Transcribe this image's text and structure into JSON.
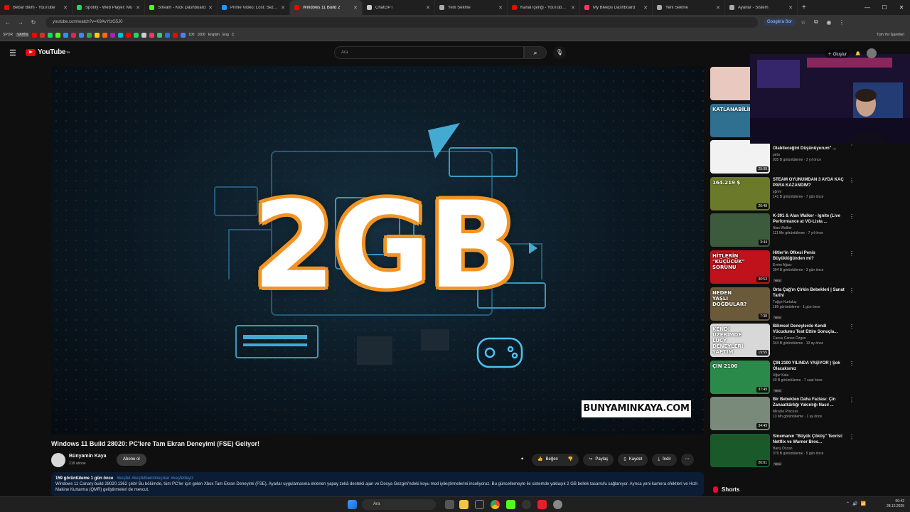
{
  "browser": {
    "tabs": [
      {
        "label": "Bebar Bilim - YouTube",
        "favicon_color": "#ff0000"
      },
      {
        "label": "Spotify - Web Player: Mu",
        "favicon_color": "#1ed760"
      },
      {
        "label": "Stream - Kick Dashboard",
        "favicon_color": "#53fc18"
      },
      {
        "label": "Prime Video: Lost: Sezon",
        "favicon_color": "#1a98ff"
      },
      {
        "label": "Windows 11 Build 2",
        "favicon_color": "#ff0000",
        "active": true
      },
      {
        "label": "ChatGPT",
        "favicon_color": "#cccccc"
      },
      {
        "label": "Yeni Sekme",
        "favicon_color": "#aaaaaa"
      },
      {
        "label": "Kanal içeriği - YouTube S",
        "favicon_color": "#ff0000"
      },
      {
        "label": "My Bleeps Dashboard",
        "favicon_color": "#ff3366"
      },
      {
        "label": "Yeni Sekme",
        "favicon_color": "#aaaaaa"
      },
      {
        "label": "Ayarlar - Sistem",
        "favicon_color": "#aaaaaa"
      }
    ],
    "url": "youtube.com/watch?v=K9AvYlzG5J0",
    "search_chip": "Google'a Sor",
    "bookmarks": [
      "SPOR",
      "VAHİN",
      "100",
      "1000",
      "English",
      "Eng",
      "C"
    ],
    "bookmark_colors": [
      "#ff0000",
      "#d93025",
      "#1ed760",
      "#53fc18",
      "#1a98ff",
      "#e91e63",
      "#4285f4",
      "#34a853",
      "#ffcc00",
      "#ff6d00",
      "#9c27b0",
      "#00bcd4",
      "#ff0000",
      "#1ed760",
      "#cccccc",
      "#ff3366",
      "#25d366",
      "#1877f2",
      "#ff0000",
      "#4285f4"
    ],
    "bookmarks_right": "Tüm Yer İşaretleri"
  },
  "youtube": {
    "logo_text": "YouTube",
    "logo_sup": "TR",
    "search_placeholder": "Ara",
    "create_label": "Oluştur"
  },
  "video": {
    "headline": "2GB",
    "watermark": "BUNYAMINKAYA.COM",
    "title": "Windows 11 Build 28020: PC'lere Tam Ekran Deneyimi (FSE) Geliyor!",
    "channel": "Bünyamin Kaya",
    "subscribers": "218 abone",
    "subscribe_label": "Abone ol",
    "actions": {
      "like": "Beğen",
      "share": "Paylaş",
      "save": "Kaydet",
      "download": "İndir"
    },
    "description_meta": "159 görüntüleme  1 gün önce",
    "description_tags": "#keşfet #keşfetbeniöneçıkar #keşfetteyiz",
    "description_text": "Windows 11 Canary build 28020.1362 çıktı! Bu bölümde, tüm PC'ler için gelen Xbox Tam Ekran Deneyimi (FSE), Ayarlar uygulamasına eklenen yapay zekâ destekli ajan ve Dosya Gezgini'ndeki koyu mod iyileştirmelerini inceliyoruz. Bu güncellemeyle ile sistemde yaklaşık 2 GB bellek tasarrufu sağlanıyor. Ayrıca yeni kamera efektleri ve Hızlı Makine Kurtarma (QMR) geliştirmeleri de mevcut."
  },
  "recommendations": [
    {
      "title": "",
      "channel": "",
      "meta": "",
      "duration": "",
      "thumb": "#e9c8c0"
    },
    {
      "title": "",
      "channel": "",
      "meta": "",
      "duration": "",
      "thumb": "#2f6f8f",
      "thumb_text": "KATLANABİLİR"
    },
    {
      "title": "Birden Fazla Evrenin Var Olabileceğini Düşünüyorum\" ...",
      "channel": "peta",
      "meta": "935 B görüntüleme · 2 yıl önce",
      "duration": "25:08",
      "thumb": "#f2f2f2"
    },
    {
      "title": "STEAM OYUNUMDAN 3 AYDA KAÇ PARA KAZANDIM?",
      "channel": "şğnm",
      "meta": "141 B görüntüleme · 7 gün önce",
      "duration": "20:48",
      "thumb": "#6b7a2a",
      "thumb_text": "164.219 $"
    },
    {
      "title": "K-391 & Alan Walker - Ignite (Live Performance at VG-Lista ...",
      "channel": "Alan Walker",
      "meta": "111 Mn görüntüleme · 7 yıl önce",
      "duration": "3:44",
      "thumb": "#3c5a3c"
    },
    {
      "title": "Hitler'in Öfkesi Penis Büyüklüğünden mi?",
      "channel": "Evrim Ağacı",
      "meta": "394 B görüntüleme · 3 gün önce",
      "duration": "30:53",
      "thumb": "#c0121a",
      "thumb_text": "HİTLERİN \"KÜÇÜCÜK\" SORUNU",
      "new": "Yeni"
    },
    {
      "title": "Orta Çağ'ın Çirkin Bebekleri | Sanat Tarihi",
      "channel": "Tuğçe Kurtuluş",
      "meta": "189 görüntüleme · 1 gün önce",
      "duration": "7:38",
      "thumb": "#6a5a3a",
      "thumb_text": "NEDEN YAŞLI DOĞDULAR?",
      "new": "Yeni"
    },
    {
      "title": "Bilimsel Deneylerde Kendi Vücudumu Test Ettim Sonuçla...",
      "channel": "Cansu Canan Özgen",
      "meta": "344 B görüntüleme · 10 ay önce",
      "duration": "19:55",
      "thumb": "#d8d8d8",
      "thumb_text": "KENDİ ÜZERİMDE LUCY DENEYLERİ YAPTIM"
    },
    {
      "title": "ÇİN 2100 YILINDA YAŞIYOR | Şok Olacaksınız",
      "channel": "Uğur Kala",
      "meta": "40 B görüntüleme · 7 saat önce",
      "duration": "37:49",
      "thumb": "#2a8a4a",
      "thumb_text": "ÇİN 2100",
      "new": "Yeni"
    },
    {
      "title": "Bir Bebekten Daha Fazlası: Çin Zanaatkârlığı Yakınlığı Nasıl ...",
      "channel": "Miracle Process",
      "meta": "13 Mn görüntüleme · 1 ay önce",
      "duration": "34:49",
      "thumb": "#7a8a7a"
    },
    {
      "title": "Sinemanın \"Büyük Çöküş\" Teorisi: Netflix ve Warner Bros...",
      "channel": "Barış Özcan",
      "meta": "379 B görüntüleme · 5 gün önce",
      "duration": "20:01",
      "thumb": "#1a5a2a",
      "new": "Yeni"
    }
  ],
  "shorts_label": "Shorts",
  "taskbar": {
    "search": "Ara",
    "time": "00:42",
    "date": "28.12.2025"
  }
}
